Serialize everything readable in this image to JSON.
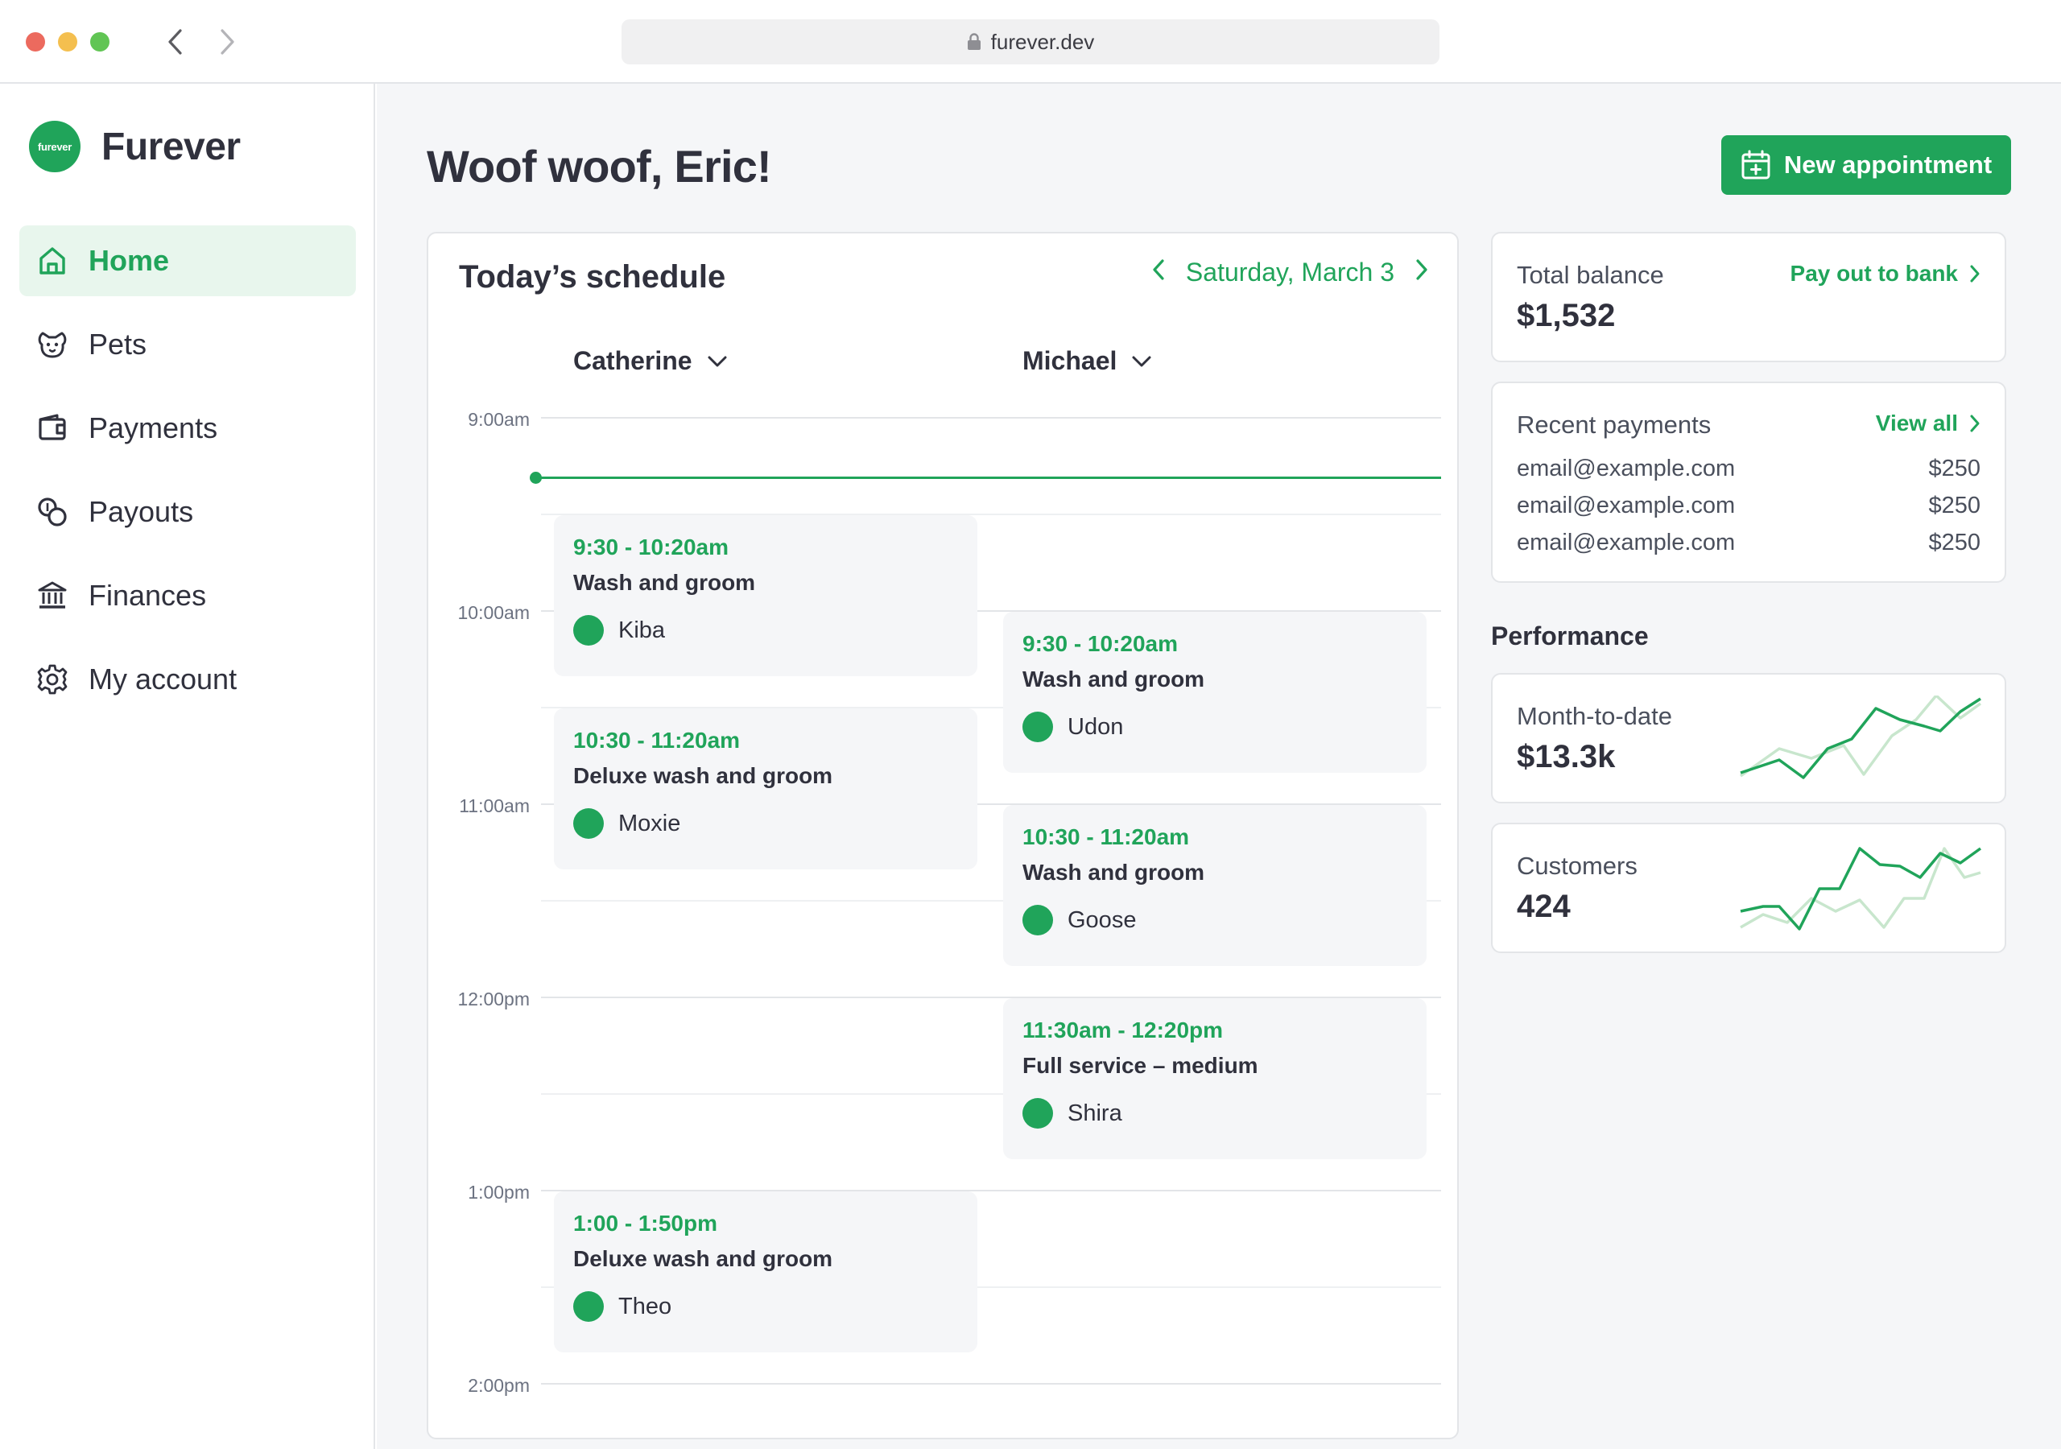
{
  "browser": {
    "url": "furever.dev"
  },
  "brand": {
    "logo_text": "furever",
    "name": "Furever"
  },
  "nav": [
    {
      "label": "Home",
      "icon": "home-icon",
      "active": true
    },
    {
      "label": "Pets",
      "icon": "paw-icon",
      "active": false
    },
    {
      "label": "Payments",
      "icon": "wallet-icon",
      "active": false
    },
    {
      "label": "Payouts",
      "icon": "coins-icon",
      "active": false
    },
    {
      "label": "Finances",
      "icon": "bank-icon",
      "active": false
    },
    {
      "label": "My account",
      "icon": "gear-icon",
      "active": false
    }
  ],
  "header": {
    "greeting": "Woof woof, Eric!",
    "new_appointment": "New appointment"
  },
  "schedule": {
    "title": "Today’s schedule",
    "date": "Saturday, March 3",
    "staff": [
      "Catherine",
      "Michael"
    ],
    "times": [
      "9:00am",
      "10:00am",
      "11:00am",
      "12:00pm",
      "1:00pm",
      "2:00pm"
    ],
    "appointments": [
      {
        "time": "9:30 - 10:20am",
        "service": "Wash and groom",
        "pet": "Kiba"
      },
      {
        "time": "10:30 - 11:20am",
        "service": "Deluxe wash and groom",
        "pet": "Moxie"
      },
      {
        "time": "1:00 - 1:50pm",
        "service": "Deluxe wash and groom",
        "pet": "Theo"
      },
      {
        "time": "9:30 - 10:20am",
        "service": "Wash and groom",
        "pet": "Udon"
      },
      {
        "time": "10:30 - 11:20am",
        "service": "Wash and groom",
        "pet": "Goose"
      },
      {
        "time": "11:30am - 12:20pm",
        "service": "Full service – medium",
        "pet": "Shira"
      }
    ]
  },
  "balance": {
    "label": "Total balance",
    "value": "$1,532",
    "link": "Pay out to bank"
  },
  "recent_payments": {
    "label": "Recent payments",
    "link": "View all",
    "rows": [
      {
        "email": "email@example.com",
        "amount": "$250"
      },
      {
        "email": "email@example.com",
        "amount": "$250"
      },
      {
        "email": "email@example.com",
        "amount": "$250"
      }
    ]
  },
  "performance": {
    "title": "Performance",
    "month_to_date": {
      "label": "Month-to-date",
      "value": "$13.3k"
    },
    "customers": {
      "label": "Customers",
      "value": "424"
    }
  },
  "colors": {
    "accent": "#20a45a",
    "accent_light": "#c8e6cd",
    "background": "#f5f6f8"
  }
}
